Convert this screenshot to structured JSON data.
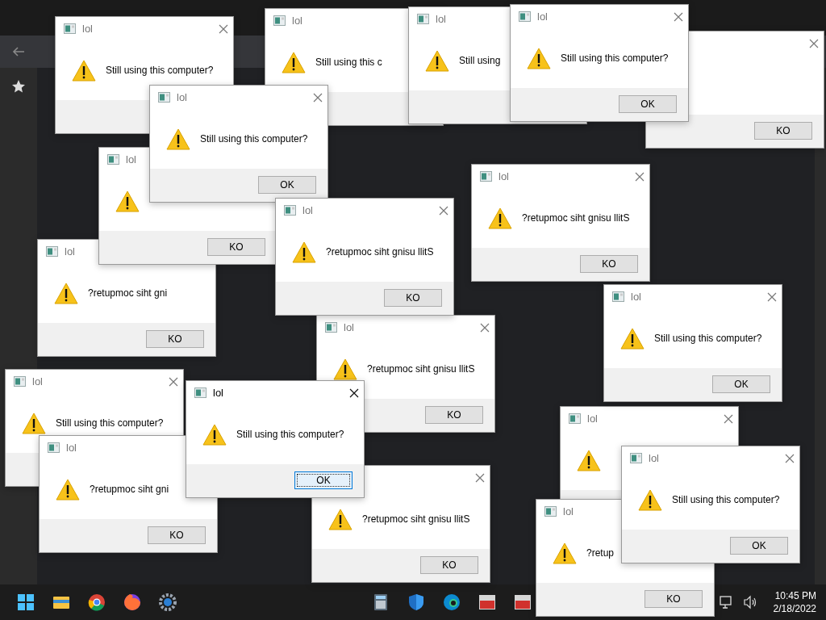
{
  "dialogs": [
    {
      "title": "lol",
      "message": "Still using this computer?",
      "active": false
    },
    {
      "title": "lol",
      "message": "Still using this c",
      "active": false
    },
    {
      "title": "lol",
      "message": "Still using",
      "active": false
    },
    {
      "button": {
        "label": "KO",
        "focused": false
      },
      "active": false
    },
    {
      "title": "lol",
      "message": "Still using this computer?",
      "button": {
        "label": "OK",
        "focused": false
      },
      "active": false
    },
    {
      "title": "lol",
      "message": "?retupmoc siht gni",
      "button": {
        "label": "KO",
        "focused": false
      },
      "active": false
    },
    {
      "title": "lol",
      "button": {
        "label": "KO",
        "focused": false
      },
      "active": false
    },
    {
      "title": "lol",
      "message": "Still using this computer?",
      "button": {
        "label": "OK",
        "focused": false
      },
      "active": false
    },
    {
      "title": "lol",
      "message": "Still using this computer?",
      "active": false
    },
    {
      "title": "lol",
      "message": "?retupmoc siht gni",
      "button": {
        "label": "KO",
        "focused": false
      },
      "active": false
    },
    {
      "title": "lol",
      "active": false
    },
    {
      "title": "lol",
      "message": "?retup",
      "button": {
        "label": "KO",
        "focused": false
      },
      "active": false
    },
    {
      "title": "lol",
      "message": "?retupmoc siht gnisu llitS",
      "button": {
        "label": "KO",
        "focused": false
      },
      "active": false
    },
    {
      "title": "lol",
      "message": "?retupmoc siht gnisu llitS",
      "button": {
        "label": "KO",
        "focused": false
      },
      "active": false
    },
    {
      "title": "lol",
      "message": "Still using this computer?",
      "button": {
        "label": "OK",
        "focused": false
      },
      "active": false
    },
    {
      "title": "lol",
      "message": "?retupmoc siht gnisu llitS",
      "button": {
        "label": "KO",
        "focused": false
      },
      "active": false
    },
    {
      "message": "?retupmoc siht gnisu llitS",
      "button": {
        "label": "KO",
        "focused": false
      },
      "active": false
    },
    {
      "title": "lol",
      "message": "Still using this computer?",
      "button": {
        "label": "OK",
        "focused": true
      },
      "active": true
    },
    {
      "title": "lol",
      "message": "Still using this computer?",
      "button": {
        "label": "OK",
        "focused": false
      },
      "active": false
    }
  ],
  "taskbar": {
    "time": "10:45 PM",
    "date": "2/18/2022"
  }
}
